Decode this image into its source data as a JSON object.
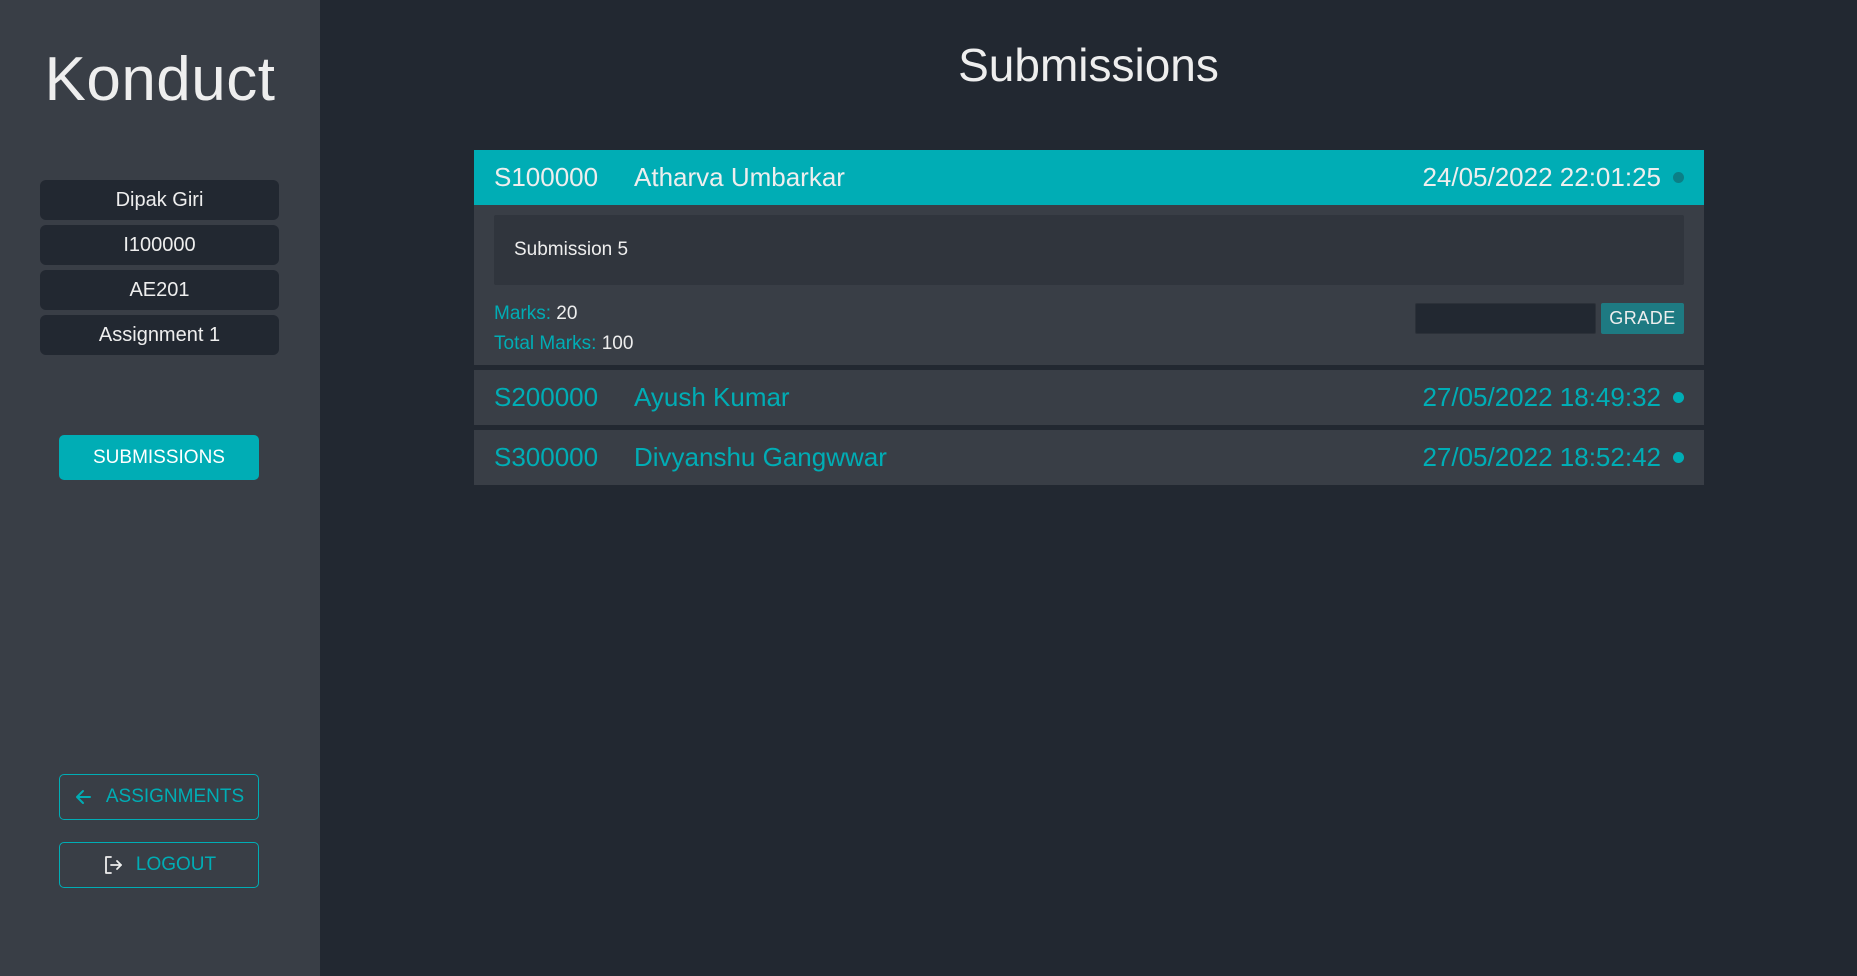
{
  "sidebar": {
    "brand": "Konduct",
    "info": [
      "Dipak Giri",
      "I100000",
      "AE201",
      "Assignment 1"
    ],
    "submissions_button": "SUBMISSIONS",
    "assignments_button": "ASSIGNMENTS",
    "logout_button": "LOGOUT",
    "icons": {
      "assignments": "arrow-left-icon",
      "logout": "logout-icon"
    }
  },
  "main": {
    "title": "Submissions",
    "submissions": [
      {
        "id": "S100000",
        "name": "Atharva Umbarkar",
        "date": "24/05/2022 22:01:25",
        "expanded": true,
        "content": "Submission 5",
        "marks_label": "Marks:",
        "marks": "20",
        "total_label": "Total Marks:",
        "total": "100",
        "grade_input_value": "",
        "grade_button": "GRADE"
      },
      {
        "id": "S200000",
        "name": "Ayush Kumar",
        "date": "27/05/2022 18:49:32",
        "expanded": false
      },
      {
        "id": "S300000",
        "name": "Divyanshu Gangwwar",
        "date": "27/05/2022 18:52:42",
        "expanded": false
      }
    ]
  },
  "colors": {
    "background": "#222831",
    "sidebar": "#393e46",
    "accent": "#00adb5",
    "text": "#eeeeee"
  }
}
